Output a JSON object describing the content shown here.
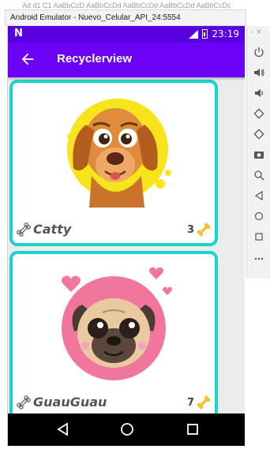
{
  "window": {
    "title": "Android Emulator - Nuevo_Celular_API_24:5554"
  },
  "background_text": "Ad d1 C1  AaBbCcD  AaBbCcDd  AaBbCcDd  AaBbCcDd  AaBbCcDc",
  "statusbar": {
    "time": "23:19",
    "logo": "N"
  },
  "appbar": {
    "title": "Recyclerview",
    "back_icon": "back-arrow-icon"
  },
  "items": [
    {
      "name": "Catty",
      "count": "3",
      "image": "dog-face-image"
    },
    {
      "name": "GuauGuau",
      "count": "7",
      "image": "pug-face-image"
    }
  ],
  "sidebar": {
    "top_controls": "- ×",
    "tools": [
      "power",
      "volume-up",
      "volume-down",
      "rotate-left",
      "rotate-right",
      "camera",
      "zoom",
      "back",
      "home",
      "overview",
      "more"
    ]
  },
  "colors": {
    "statusbar": "#5800e0",
    "appbar": "#6a00f4",
    "card_border": "#17d4cc",
    "navbar": "#000000"
  }
}
